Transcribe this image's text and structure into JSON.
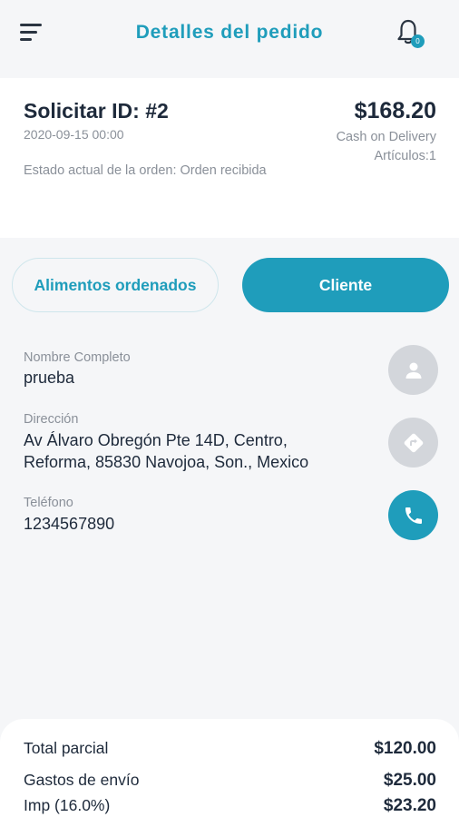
{
  "header": {
    "title": "Detalles del pedido",
    "notification_count": "0",
    "menu_icon": "hamburger-menu-icon",
    "bell_icon": "bell-icon"
  },
  "order": {
    "id_label": "Solicitar ID: #2",
    "date": "2020-09-15 00:00",
    "status": "Estado actual de la orden: Orden recibida",
    "total": "$168.20",
    "payment_method": "Cash on Delivery",
    "items": "Artículos:1"
  },
  "tabs": {
    "food": "Alimentos ordenados",
    "client": "Cliente",
    "active": "client"
  },
  "customer": {
    "name_label": "Nombre Completo",
    "name": "prueba",
    "address_label": "Dirección",
    "address_line1": "Av Álvaro Obregón Pte 14D, Centro,",
    "address_line2": "Reforma, 85830 Navojoa, Son., Mexico",
    "phone_label": "Teléfono",
    "phone": "1234567890"
  },
  "summary": {
    "subtotal_label": "Total parcial",
    "subtotal": "$120.00",
    "shipping_label": "Gastos de envío",
    "shipping": "$25.00",
    "tax_label": "Imp (16.0%)",
    "tax": "$23.20"
  },
  "colors": {
    "accent": "#1f9dbb",
    "text": "#1e2a3b",
    "muted": "#8a9099",
    "background": "#f5f6f8",
    "icon_gray": "#d3d6db"
  }
}
